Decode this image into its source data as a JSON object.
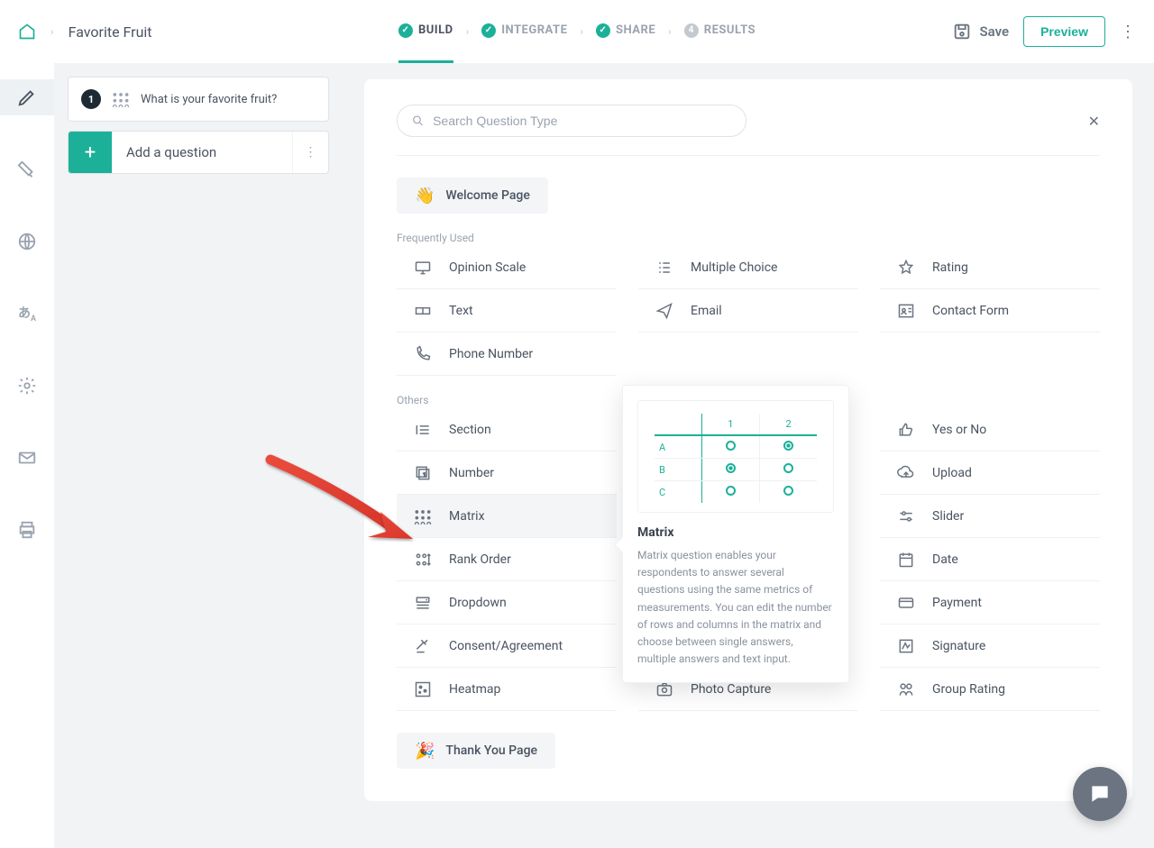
{
  "header": {
    "survey_title": "Favorite Fruit",
    "tabs": [
      {
        "label": "BUILD",
        "state": "done"
      },
      {
        "label": "INTEGRATE",
        "state": "done"
      },
      {
        "label": "SHARE",
        "state": "done"
      },
      {
        "label": "RESULTS",
        "step": "4"
      }
    ],
    "save": "Save",
    "preview": "Preview"
  },
  "sidebar": {
    "question_number": "1",
    "question_text": "What is your favorite fruit?",
    "add_question": "Add a question"
  },
  "search": {
    "placeholder": "Search Question Type"
  },
  "special": {
    "welcome": "Welcome Page",
    "thankyou": "Thank You Page"
  },
  "sections": {
    "freq_label": "Frequently Used",
    "others_label": "Others"
  },
  "freq": {
    "opinion": "Opinion Scale",
    "multiple": "Multiple Choice",
    "rating": "Rating",
    "text": "Text",
    "email": "Email",
    "contact": "Contact Form",
    "phone": "Phone Number"
  },
  "others": {
    "section": "Section",
    "number": "Number",
    "matrix": "Matrix",
    "rank": "Rank Order",
    "dropdown": "Dropdown",
    "consent": "Consent/Agreement",
    "heatmap": "Heatmap",
    "photo": "Photo Capture",
    "yesno": "Yes or No",
    "upload": "Upload",
    "slider": "Slider",
    "date": "Date",
    "payment": "Payment",
    "signature": "Signature",
    "groupRating": "Group Rating"
  },
  "popover": {
    "title": "Matrix",
    "desc": "Matrix question enables your respondents to answer several questions using the same metrics of measurements. You can edit the number of rows and columns in the matrix and choose between single answers, multiple answers and text input."
  }
}
